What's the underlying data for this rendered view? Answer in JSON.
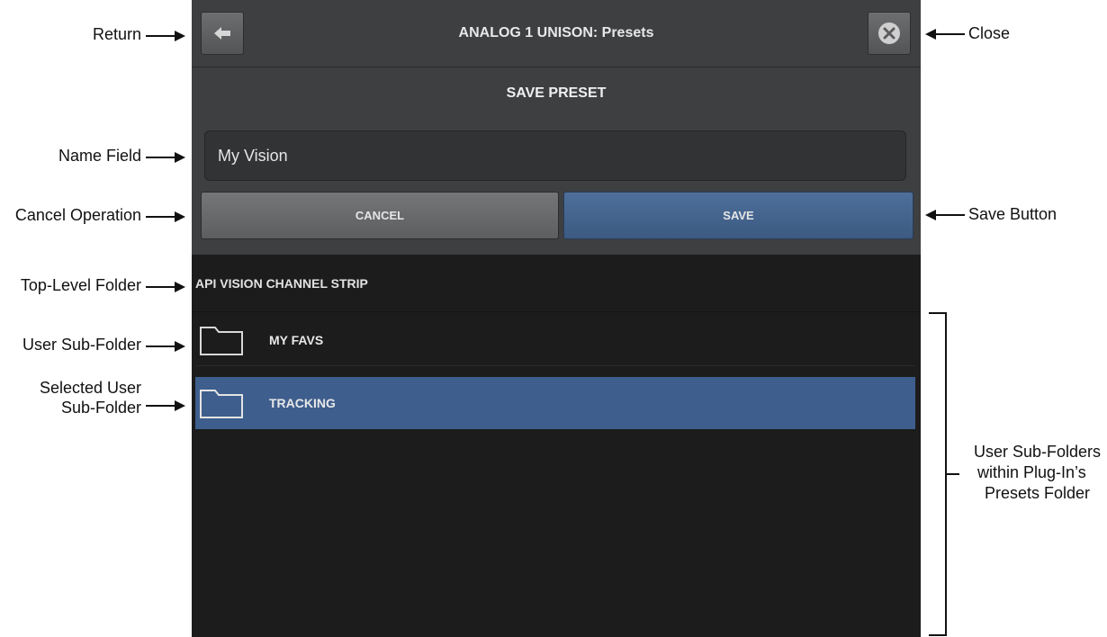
{
  "window": {
    "title": "ANALOG 1 UNISON: Presets",
    "section_title": "SAVE PRESET"
  },
  "form": {
    "name_value": "My Vision",
    "cancel_label": "CANCEL",
    "save_label": "SAVE"
  },
  "browser": {
    "top_level_folder": "API VISION CHANNEL STRIP",
    "folders": [
      {
        "label": "MY FAVS",
        "selected": false
      },
      {
        "label": "TRACKING",
        "selected": true
      }
    ]
  },
  "annotations": {
    "return": "Return",
    "close": "Close",
    "name_field": "Name Field",
    "cancel_operation": "Cancel Operation",
    "save_button": "Save Button",
    "top_level_folder": "Top-Level Folder",
    "user_sub_folder": "User Sub-Folder",
    "selected_line1": "Selected User",
    "selected_line2": "Sub-Folder",
    "subfolders_line1": "User Sub-Folders",
    "subfolders_line2": "within Plug-In’s",
    "subfolders_line3": "Presets Folder"
  },
  "colors": {
    "header_bg": "#3d3f41",
    "list_bg": "#1c1c1c",
    "save_blue": "#3e5e8d",
    "selection_blue": "#3e5e8d"
  },
  "icons": [
    "arrow-left-icon",
    "close-circle-icon",
    "folder-icon"
  ]
}
